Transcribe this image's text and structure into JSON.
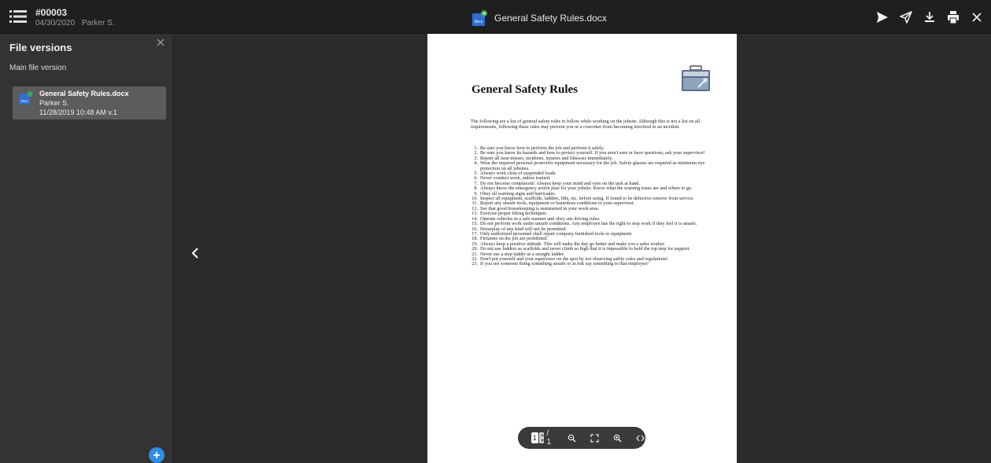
{
  "record": {
    "id": "#00003",
    "date": "04/30/2020",
    "author": "Parker S."
  },
  "document": {
    "title": "General Safety Rules.docx"
  },
  "icons": {
    "menu": "list-menu-icon",
    "send": "send-icon",
    "share": "paper-plane-icon",
    "download": "download-icon",
    "print": "printer-icon",
    "close": "close-icon"
  },
  "sidebar": {
    "title": "File versions",
    "subtitle": "Main file version",
    "versions": [
      {
        "name": "General Safety Rules.docx",
        "author": "Parker S.",
        "date": "11/28/2019 10:48 AM v.1",
        "icon_label": "docx"
      }
    ]
  },
  "page": {
    "heading": "General Safety Rules",
    "intro": "The following are a list of general safety rules to follow while working on the jobsite.  Although this is not a list on all requirements, following these rules may prevent you or a coworker from becoming involved in an incident.",
    "rules": [
      {
        "num": "1.",
        "text": "Be sure you know how to perform the job and perform it safely."
      },
      {
        "num": "2.",
        "text": "Be sure you know its hazards and how to protect yourself.  If you aren't sure or have questions, ask your supervisor!"
      },
      {
        "num": "3.",
        "text": "Report all near misses, incidents, injuries and illnesses immediately."
      },
      {
        "num": "4.",
        "text": "Wear the required personal protective equipment necessary for the job.  Safety glasses are required as minimum eye protection on all jobsites."
      },
      {
        "num": "5.",
        "text": "Always work clear of suspended loads."
      },
      {
        "num": "6.",
        "text": "Never conduct work, unless trained."
      },
      {
        "num": "7.",
        "text": "Do not become complacent!  Always keep your mind and eyes on the task at hand."
      },
      {
        "num": "8.",
        "text": "Always know the emergency action plan for your jobsite.  Know what the warning tones are and where to go."
      },
      {
        "num": "9.",
        "text": "Obey all warning signs and barricades."
      },
      {
        "num": "10.",
        "text": "Inspect all equipment, scaffolds, ladders, lifts, etc. before using.  If found to be defective remove from service."
      },
      {
        "num": "11.",
        "text": "Report any unsafe tools, equipment or hazardous conditions to your supervisor."
      },
      {
        "num": "12.",
        "text": "See that good housekeeping is maintained in your work area."
      },
      {
        "num": "13.",
        "text": "Exercise proper lifting techniques."
      },
      {
        "num": "14.",
        "text": "Operate vehicles in a safe manner and obey site driving rules."
      },
      {
        "num": "15.",
        "text": "Do not perform work under unsafe conditions.  Any employee has the right to stop work if they feel it is unsafe."
      },
      {
        "num": "16.",
        "text": "Horseplay of any kind will not be permitted."
      },
      {
        "num": "17.",
        "text": "Only authorized personnel shall repair company furnished tools or equipment."
      },
      {
        "num": "18.",
        "text": "Firearms on the job are prohibited."
      },
      {
        "num": "19.",
        "text": "Always keep a positive attitude.  This will make the day go better and make you a safer worker."
      },
      {
        "num": "20.",
        "text": "Do not use ladders as scaffolds and never climb so high that it is impossible to hold the top step for support."
      },
      {
        "num": "21.",
        "text": "Never use a step ladder as a straight ladder."
      },
      {
        "num": "22.",
        "text": "Don't put yourself and your supervisor on the spot by not observing safety rules and regulations!"
      },
      {
        "num": "23.",
        "text": "If you see someone doing something unsafe or at risk say something to that employee!"
      }
    ]
  },
  "pager": {
    "current": "1",
    "total": "/ 1"
  },
  "colors": {
    "accent": "#2e8fe6",
    "topbar": "#1f1f1f",
    "sidebar": "#333333",
    "selected": "#5c5c5c"
  }
}
